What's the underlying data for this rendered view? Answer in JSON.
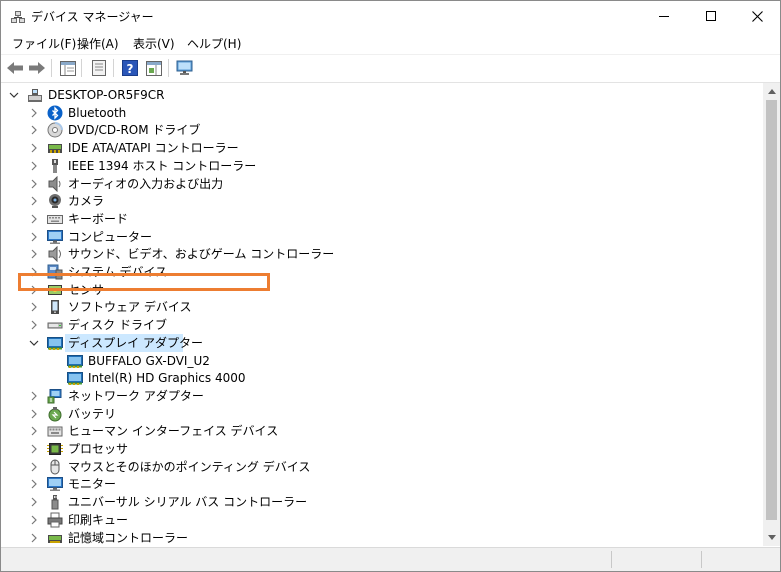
{
  "window": {
    "title": "デバイス マネージャー"
  },
  "menu": [
    {
      "label": "ファイル(F)"
    },
    {
      "label": "操作(A)"
    },
    {
      "label": "表示(V)"
    },
    {
      "label": "ヘルプ(H)"
    }
  ],
  "tree": {
    "root": "DESKTOP-OR5F9CR",
    "categories": [
      {
        "label": "Bluetooth",
        "icon": "bluetooth-icon"
      },
      {
        "label": "DVD/CD-ROM ドライブ",
        "icon": "disc-drive-icon"
      },
      {
        "label": "IDE ATA/ATAPI コントローラー",
        "icon": "ide-controller-icon"
      },
      {
        "label": "IEEE 1394 ホスト コントローラー",
        "icon": "firewire-icon"
      },
      {
        "label": "オーディオの入力および出力",
        "icon": "speaker-icon"
      },
      {
        "label": "カメラ",
        "icon": "camera-icon"
      },
      {
        "label": "キーボード",
        "icon": "keyboard-icon"
      },
      {
        "label": "コンピューター",
        "icon": "computer-icon"
      },
      {
        "label": "サウンド、ビデオ、およびゲーム コントローラー",
        "icon": "sound-icon"
      },
      {
        "label": "システム デバイス",
        "icon": "system-device-icon"
      },
      {
        "label": "センサー",
        "icon": "sensor-icon"
      },
      {
        "label": "ソフトウェア デバイス",
        "icon": "software-device-icon"
      },
      {
        "label": "ディスク ドライブ",
        "icon": "disk-drive-icon"
      },
      {
        "label": "ディスプレイ アダプター",
        "icon": "display-adapter-icon",
        "expanded": true,
        "selected": true,
        "children": [
          {
            "label": "BUFFALO GX-DVI_U2",
            "icon": "display-adapter-icon",
            "highlighted": true
          },
          {
            "label": "Intel(R) HD Graphics 4000",
            "icon": "display-adapter-icon"
          }
        ]
      },
      {
        "label": "ネットワーク アダプター",
        "icon": "network-icon"
      },
      {
        "label": "バッテリ",
        "icon": "battery-icon"
      },
      {
        "label": "ヒューマン インターフェイス デバイス",
        "icon": "hid-icon"
      },
      {
        "label": "プロセッサ",
        "icon": "processor-icon"
      },
      {
        "label": "マウスとそのほかのポインティング デバイス",
        "icon": "mouse-icon"
      },
      {
        "label": "モニター",
        "icon": "monitor-icon"
      },
      {
        "label": "ユニバーサル シリアル バス コントローラー",
        "icon": "usb-icon"
      },
      {
        "label": "印刷キュー",
        "icon": "printer-icon"
      },
      {
        "label": "記憶域コントローラー",
        "icon": "storage-controller-icon"
      }
    ]
  },
  "colors": {
    "selection": "#cce8ff",
    "highlight_box": "#ed7d31",
    "accent": "#0078d7"
  }
}
